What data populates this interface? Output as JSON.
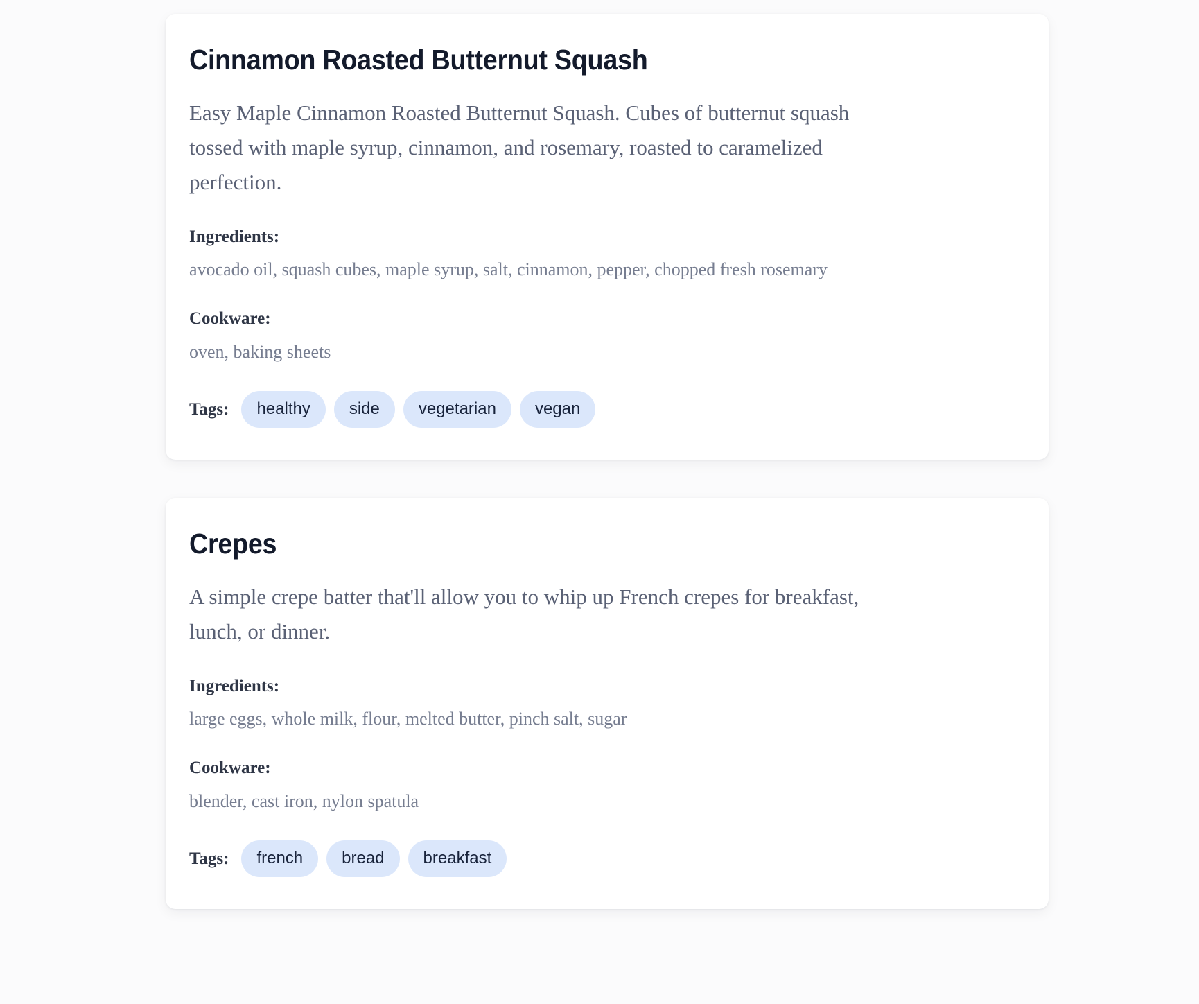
{
  "theme": {
    "page_background": "#fbfbfc",
    "card_background": "#ffffff",
    "title_color": "#131a2b",
    "description_color": "#5a6175",
    "label_color": "#2f3646",
    "value_color": "#767d90",
    "tag_background": "#dbe7fb",
    "tag_text_color": "#18233b"
  },
  "labels": {
    "ingredients": "Ingredients:",
    "cookware": "Cookware:",
    "tags": "Tags:"
  },
  "recipes": [
    {
      "title": "Cinnamon Roasted Butternut Squash",
      "description": "Easy Maple Cinnamon Roasted Butternut Squash. Cubes of butternut squash tossed with maple syrup, cinnamon, and rosemary, roasted to caramelized perfection.",
      "ingredients": "avocado oil, squash cubes, maple syrup, salt, cinnamon, pepper, chopped fresh rosemary",
      "cookware": "oven, baking sheets",
      "tags": [
        "healthy",
        "side",
        "vegetarian",
        "vegan"
      ]
    },
    {
      "title": "Crepes",
      "description": "A simple crepe batter that'll allow you to whip up French crepes for breakfast, lunch, or dinner.",
      "ingredients": "large eggs, whole milk, flour, melted butter, pinch salt, sugar",
      "cookware": "blender, cast iron, nylon spatula",
      "tags": [
        "french",
        "bread",
        "breakfast"
      ]
    }
  ]
}
